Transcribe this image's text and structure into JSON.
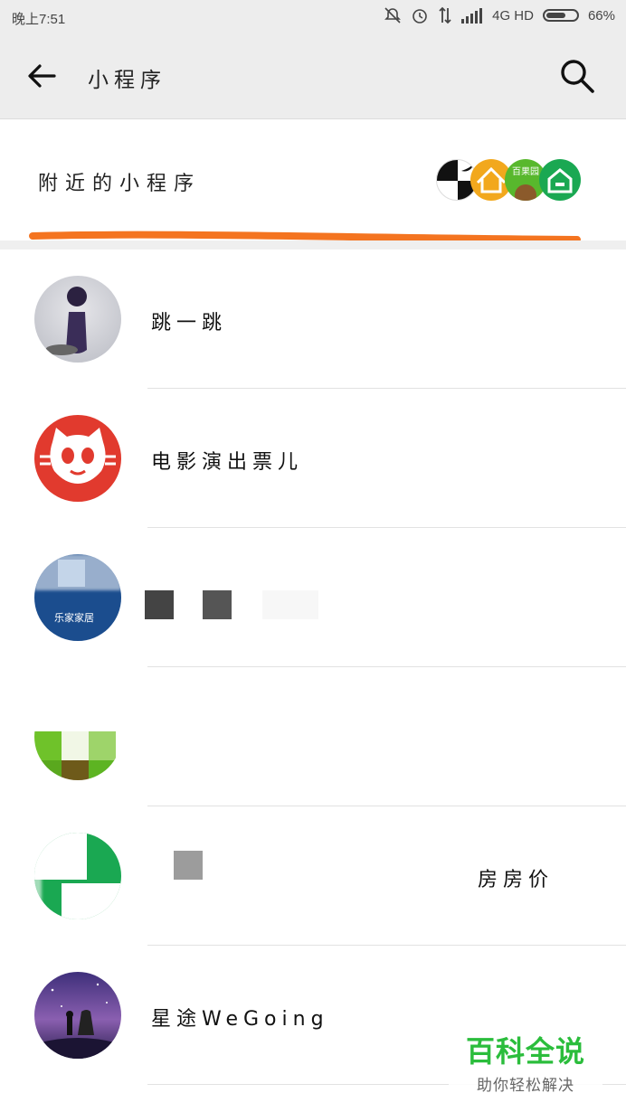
{
  "status_bar": {
    "time": "晚上7:51",
    "network": "4G HD",
    "battery": "66%",
    "battery_level": 0.66
  },
  "header": {
    "title": "小程序"
  },
  "nearby": {
    "label": "附近的小程序",
    "icon_text": "百果园"
  },
  "mini_programs": [
    {
      "name": "跳一跳",
      "icon": "jump-jump-icon"
    },
    {
      "name": "电影演出票儿",
      "icon": "cat-eye-icon",
      "brand_color": "#e13a2e"
    },
    {
      "name": "",
      "icon": "lejia-icon",
      "icon_text": "乐家家居",
      "brand_color": "#1b4d8e"
    },
    {
      "name": "",
      "icon": "pixelated-icon"
    },
    {
      "name": "房房价",
      "icon": "house-price-icon",
      "brand_color": "#1aa852"
    },
    {
      "name": "星途WeGoing",
      "icon": "wegoing-icon"
    }
  ],
  "watermark": {
    "title": "百科全说",
    "subtitle": "助你轻松解决"
  },
  "colors": {
    "accent_underline": "#f47420",
    "wechat_green": "#2bbd3c"
  }
}
